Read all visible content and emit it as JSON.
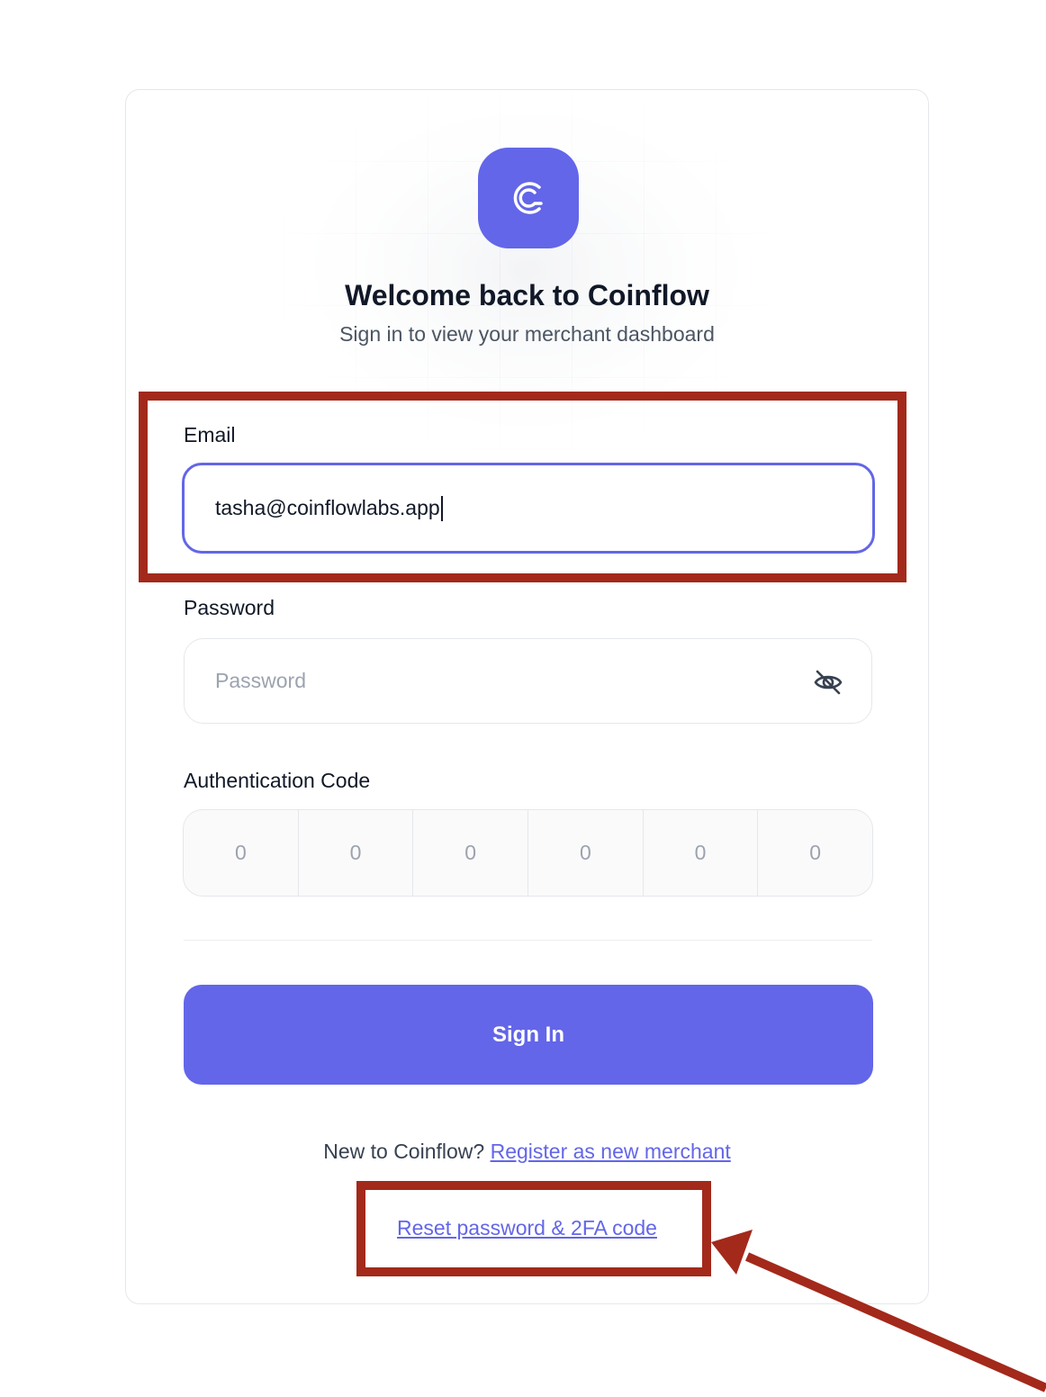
{
  "header": {
    "logo_icon": "coinflow-logo-icon",
    "title": "Welcome back to Coinflow",
    "subtitle": "Sign in to view your merchant dashboard"
  },
  "form": {
    "email": {
      "label": "Email",
      "value": "tasha@coinflowlabs.app"
    },
    "password": {
      "label": "Password",
      "placeholder": "Password",
      "toggle_icon": "eye-slash-icon"
    },
    "auth_code": {
      "label": "Authentication Code",
      "digits": [
        "0",
        "0",
        "0",
        "0",
        "0",
        "0"
      ]
    },
    "submit_label": "Sign In"
  },
  "footer": {
    "register_prompt": "New to Coinflow?",
    "register_link": "Register as new merchant",
    "reset_link": "Reset password & 2FA code"
  },
  "colors": {
    "accent": "#6366e8",
    "annotation": "#a3291b"
  }
}
